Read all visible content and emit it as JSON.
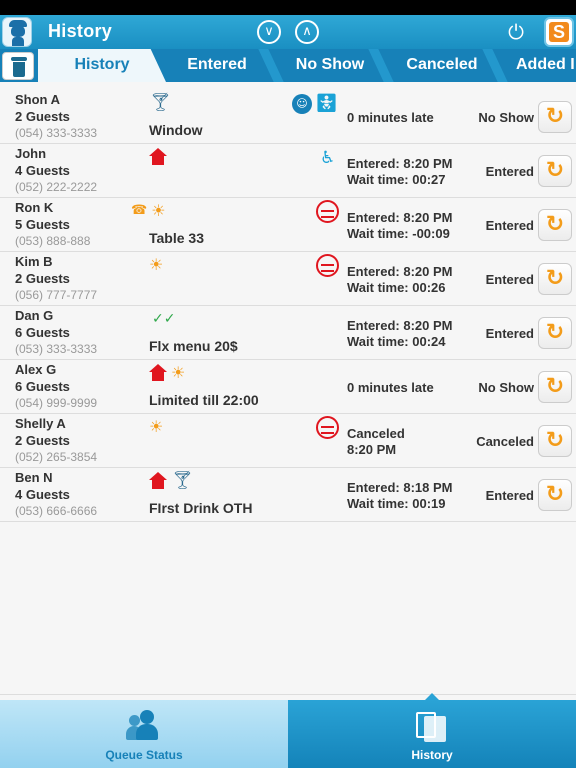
{
  "header": {
    "title": "History",
    "down_icon": "chevron-down-icon",
    "up_icon": "chevron-up-icon",
    "power_icon": "power-icon",
    "brand_letter": "S"
  },
  "tabs": [
    {
      "label": "History",
      "active": true
    },
    {
      "label": "Entered"
    },
    {
      "label": "No Show"
    },
    {
      "label": "Canceled"
    },
    {
      "label": "Added I"
    }
  ],
  "rows": [
    {
      "name": "Shon A",
      "guests": "2 Guests",
      "phone": "(054) 333-3333",
      "note": "Window",
      "info1": "0 minutes late",
      "info2": "",
      "state": "No Show",
      "icons": [
        "cocktail-icon"
      ],
      "mid_icons": [
        "baby-icon",
        "stroller-icon"
      ]
    },
    {
      "name": "John",
      "guests": "4 Guests",
      "phone": "(052) 222-2222",
      "note": "",
      "info1": "Entered: 8:20 PM",
      "info2": "Wait time: 00:27",
      "state": "Entered",
      "icons": [
        "house-icon"
      ],
      "mid_icons": [
        "wheelchair-icon"
      ]
    },
    {
      "name": "Ron K",
      "guests": "5 Guests",
      "phone": "(053) 888-888",
      "note": "Table 33",
      "info1": "Entered: 8:20 PM",
      "info2": "Wait time: -00:09",
      "state": "Entered",
      "icons": [
        "phone-icon",
        "sun-icon"
      ],
      "mid_icons": [
        "no-smoking-icon"
      ]
    },
    {
      "name": "Kim B",
      "guests": "2 Guests",
      "phone": "(056) 777-7777",
      "note": "",
      "info1": "Entered: 8:20 PM",
      "info2": "Wait time: 00:26",
      "state": "Entered",
      "icons": [
        "sun-icon"
      ],
      "mid_icons": [
        "no-smoking-icon"
      ]
    },
    {
      "name": "Dan G",
      "guests": "6 Guests",
      "phone": "(053) 333-3333",
      "note": "Flx menu 20$",
      "info1": "Entered: 8:20 PM",
      "info2": "Wait time: 00:24",
      "state": "Entered",
      "icons": [
        "double-check-icon"
      ],
      "mid_icons": []
    },
    {
      "name": "Alex G",
      "guests": "6 Guests",
      "phone": "(054) 999-9999",
      "note": "Limited till 22:00",
      "info1": "0 minutes late",
      "info2": "",
      "state": "No Show",
      "icons": [
        "house-icon",
        "sun-icon"
      ],
      "mid_icons": []
    },
    {
      "name": "Shelly A",
      "guests": "2 Guests",
      "phone": "(052) 265-3854",
      "note": "",
      "info1": "Canceled",
      "info2": "8:20 PM",
      "state": "Canceled",
      "icons": [
        "sun-icon"
      ],
      "mid_icons": [
        "no-smoking-icon"
      ]
    },
    {
      "name": "Ben N",
      "guests": "4 Guests",
      "phone": "(053) 666-6666",
      "note": "FIrst Drink OTH",
      "info1": "Entered: 8:18 PM",
      "info2": "Wait time: 00:19",
      "state": "Entered",
      "icons": [
        "house-icon",
        "cocktail-icon"
      ],
      "mid_icons": []
    }
  ],
  "bottom_tabs": [
    {
      "label": "Queue Status"
    },
    {
      "label": "History",
      "active": true
    }
  ],
  "colors": {
    "header": "#1a8fc2",
    "tab_bar": "#1781b8",
    "accent_orange": "#f39c1a",
    "alert_red": "#e0161f"
  }
}
